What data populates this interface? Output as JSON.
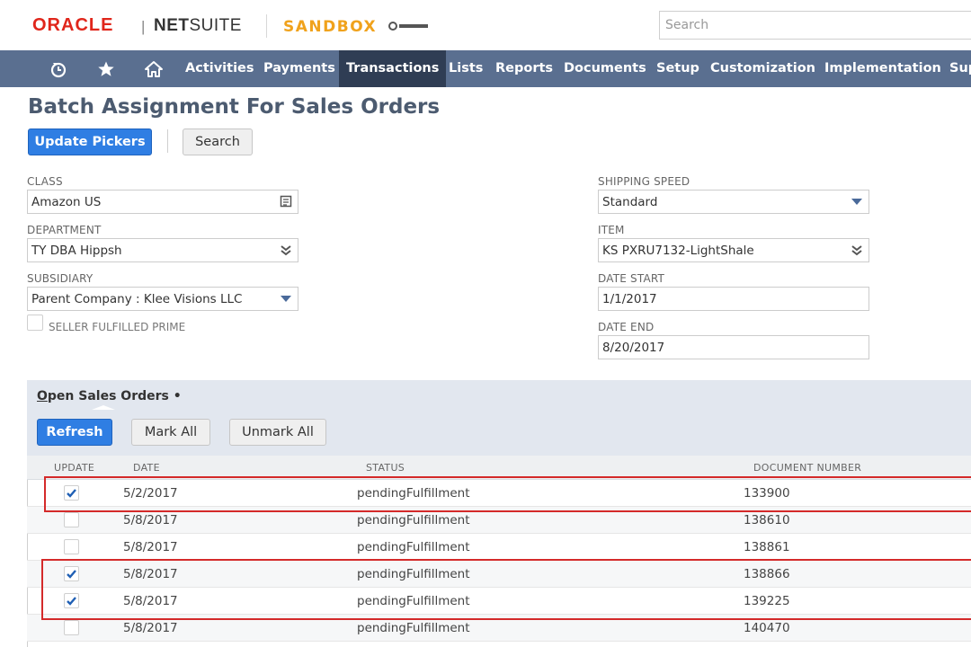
{
  "header": {
    "brand_oracle": "ORACLE",
    "brand_separator": "|",
    "brand_net": "NET",
    "brand_suite": "SUITE",
    "environment": "SANDBOX",
    "search_placeholder": "Search"
  },
  "nav": {
    "icons": [
      "recent-records-icon",
      "star-icon",
      "home-icon"
    ],
    "items": [
      "Activities",
      "Payments",
      "Transactions",
      "Lists",
      "Reports",
      "Documents",
      "Setup",
      "Customization",
      "Implementation",
      "Sup"
    ],
    "active": "Transactions"
  },
  "page": {
    "title": "Batch Assignment For Sales Orders",
    "update_pickers_label": "Update Pickers",
    "search_label": "Search"
  },
  "form": {
    "class_label": "CLASS",
    "class_value": "Amazon US",
    "department_label": "DEPARTMENT",
    "department_value": "TY DBA Hippsh",
    "subsidiary_label": "SUBSIDIARY",
    "subsidiary_value": "Parent Company : Klee Visions LLC",
    "seller_fulfilled_label": "SELLER FULFILLED PRIME",
    "seller_fulfilled_checked": false,
    "shipping_speed_label": "SHIPPING SPEED",
    "shipping_speed_value": "Standard",
    "item_label": "ITEM",
    "item_value": "KS PXRU7132-LightShale",
    "date_start_label": "DATE START",
    "date_start_value": "1/1/2017",
    "date_end_label": "DATE END",
    "date_end_value": "8/20/2017"
  },
  "sublist": {
    "tab_title_underlined": "O",
    "tab_title_rest": "pen Sales Orders",
    "tab_marker": "•",
    "refresh_label": "Refresh",
    "mark_all_label": "Mark All",
    "unmark_all_label": "Unmark All",
    "columns": [
      "UPDATE",
      "DATE",
      "STATUS",
      "DOCUMENT NUMBER"
    ],
    "rows": [
      {
        "checked": true,
        "date": "5/2/2017",
        "status": "pendingFulfillment",
        "doc": "133900"
      },
      {
        "checked": false,
        "date": "5/8/2017",
        "status": "pendingFulfillment",
        "doc": "138610"
      },
      {
        "checked": false,
        "date": "5/8/2017",
        "status": "pendingFulfillment",
        "doc": "138861"
      },
      {
        "checked": true,
        "date": "5/8/2017",
        "status": "pendingFulfillment",
        "doc": "138866"
      },
      {
        "checked": true,
        "date": "5/8/2017",
        "status": "pendingFulfillment",
        "doc": "139225"
      },
      {
        "checked": false,
        "date": "5/8/2017",
        "status": "pendingFulfillment",
        "doc": "140470"
      }
    ]
  },
  "colors": {
    "nav_bg": "#5a6f90",
    "nav_active": "#2f3d54",
    "primary_button": "#2f7ee3",
    "highlight_box": "#d42a2a",
    "checkmark": "#1f5fb4",
    "oracle_red": "#e0261b",
    "sandbox_orange": "#f0a21c"
  }
}
